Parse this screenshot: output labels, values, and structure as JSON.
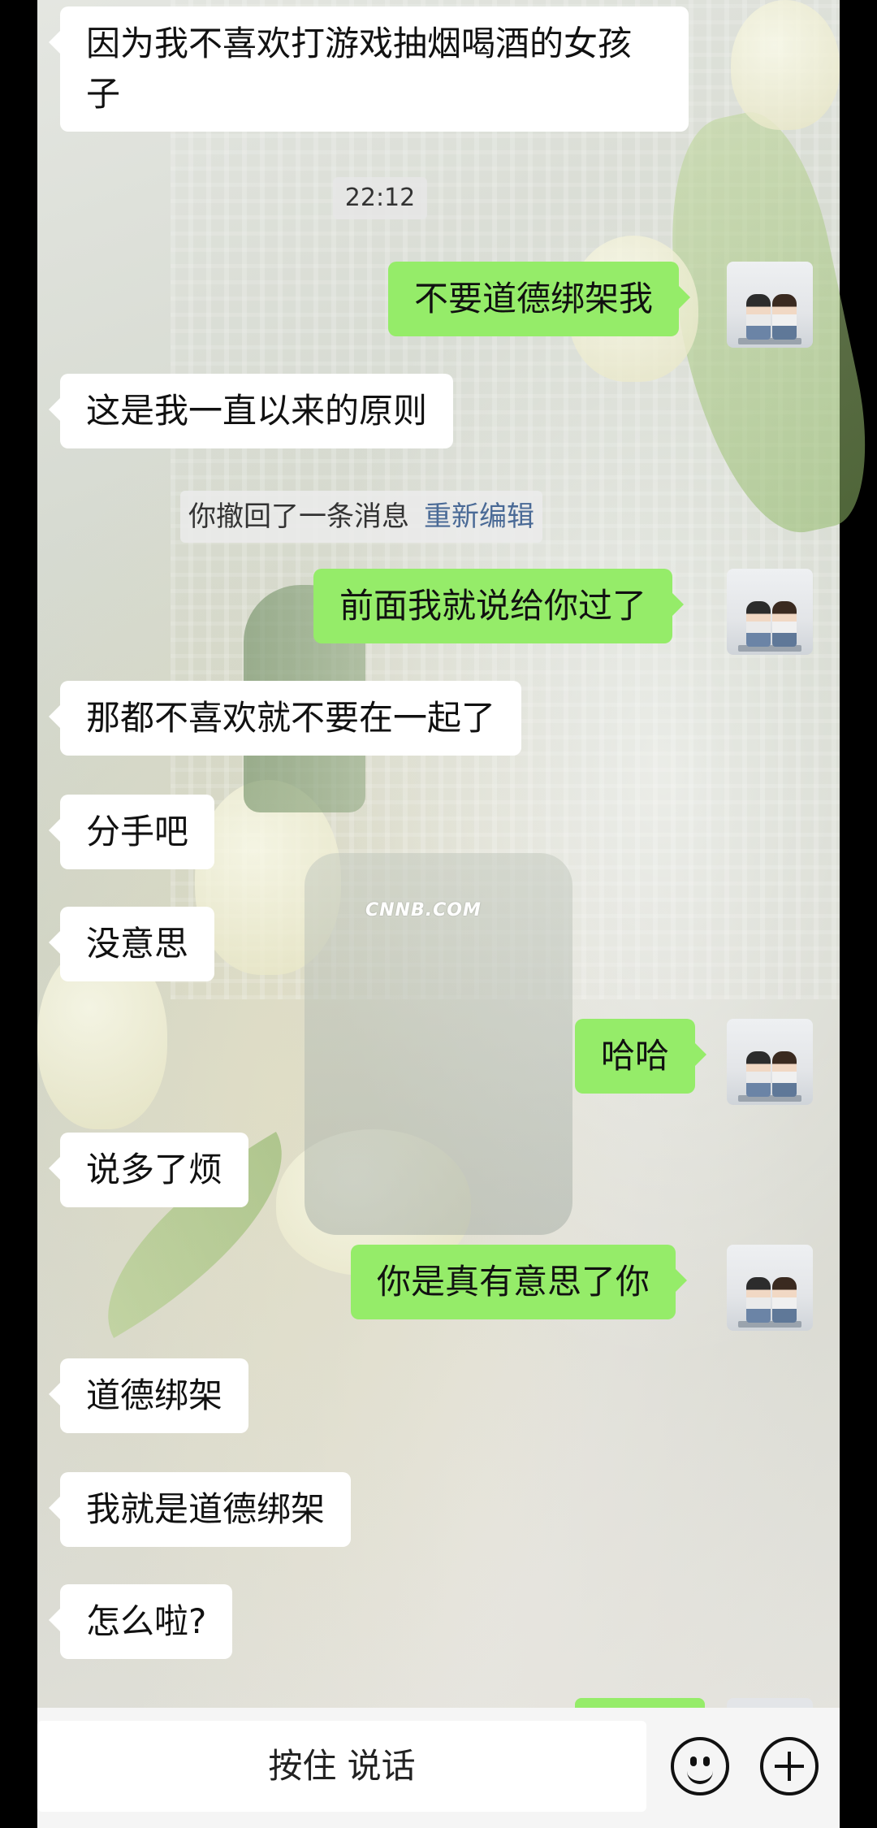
{
  "watermark": "CNNB.COM",
  "timestamp": "22:12",
  "system_notice": {
    "text": "你撤回了一条消息",
    "action": "重新编辑"
  },
  "messages": [
    {
      "side": "left",
      "text": "因为我不喜欢打游戏抽烟喝酒的女孩子"
    },
    {
      "side": "right",
      "text": "不要道德绑架我"
    },
    {
      "side": "left",
      "text": "这是我一直以来的原则"
    },
    {
      "side": "right",
      "text": "前面我就说给你过了"
    },
    {
      "side": "left",
      "text": "那都不喜欢就不要在一起了"
    },
    {
      "side": "left",
      "text": "分手吧"
    },
    {
      "side": "left",
      "text": "没意思"
    },
    {
      "side": "right",
      "text": "哈哈"
    },
    {
      "side": "left",
      "text": "说多了烦"
    },
    {
      "side": "right",
      "text": "你是真有意思了你"
    },
    {
      "side": "left",
      "text": "道德绑架"
    },
    {
      "side": "left",
      "text": "我就是道德绑架"
    },
    {
      "side": "left",
      "text": "怎么啦?"
    }
  ],
  "input_bar": {
    "voice_button": "按住 说话",
    "emoji_icon": "emoji-icon",
    "plus_icon": "plus-icon"
  },
  "colors": {
    "sent_bubble": "#95ec69",
    "received_bubble": "#ffffff"
  }
}
